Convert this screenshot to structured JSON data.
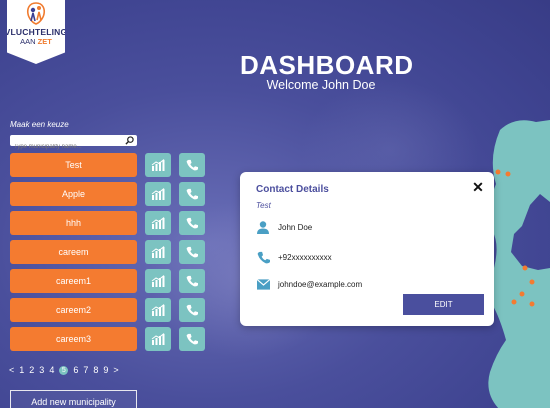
{
  "logo": {
    "line1": "VLUCHTELING",
    "line2_a": "AAN ",
    "line2_b": "ZET"
  },
  "header": {
    "title": "DASHBOARD",
    "welcome": "Welcome John Doe"
  },
  "sidebar": {
    "choose_label": "Maak een keuze",
    "search_placeholder": "Type municipality name...",
    "municipalities": [
      "Test",
      "Apple",
      "hhh",
      "careem",
      "careem1",
      "careem2",
      "careem3"
    ],
    "add_label": "Add new municipality"
  },
  "pagination": {
    "prev": "<",
    "pages": [
      "1",
      "2",
      "3",
      "4",
      "5",
      "6",
      "7",
      "8",
      "9"
    ],
    "current": "5",
    "next": ">"
  },
  "contact": {
    "title": "Contact Details",
    "subtitle": "Test",
    "close": "✕",
    "name": "John Doe",
    "phone": "+92xxxxxxxxxx",
    "email": "johndoe@example.com",
    "edit_label": "EDIT"
  },
  "colors": {
    "primary": "#4a4f9e",
    "accent": "#f47b30",
    "teal": "#7cc3c1"
  },
  "icons": {
    "stats": "bar-chart-icon",
    "call": "phone-icon",
    "search": "search-icon",
    "user": "user-icon",
    "mail": "mail-icon"
  }
}
